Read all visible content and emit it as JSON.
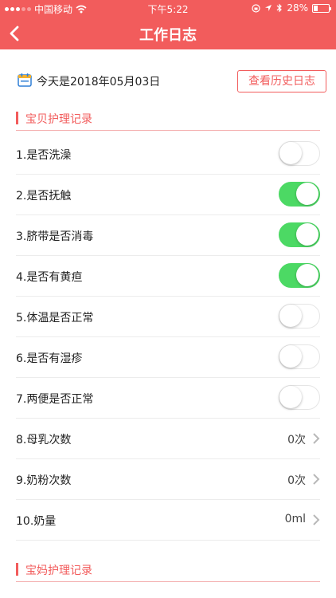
{
  "status_bar": {
    "carrier": "中国移动",
    "time": "下午5:22",
    "battery_pct": "28%",
    "battery_level": 0.28
  },
  "header": {
    "title": "工作日志"
  },
  "date": {
    "text": "今天是2018年05月03日",
    "history_btn": "查看历史日志"
  },
  "sections": {
    "baby": "宝贝护理记录",
    "mom": "宝妈护理记录"
  },
  "rows": [
    {
      "label": "1.是否洗澡",
      "type": "toggle",
      "on": false
    },
    {
      "label": "2.是否抚触",
      "type": "toggle",
      "on": true
    },
    {
      "label": "3.脐带是否消毒",
      "type": "toggle",
      "on": true
    },
    {
      "label": "4.是否有黄疸",
      "type": "toggle",
      "on": true
    },
    {
      "label": "5.体温是否正常",
      "type": "toggle",
      "on": false
    },
    {
      "label": "6.是否有湿疹",
      "type": "toggle",
      "on": false
    },
    {
      "label": "7.两便是否正常",
      "type": "toggle",
      "on": false
    },
    {
      "label": "8.母乳次数",
      "type": "value",
      "value": "0次"
    },
    {
      "label": "9.奶粉次数",
      "type": "value",
      "value": "0次"
    },
    {
      "label": "10.奶量",
      "type": "value",
      "value": "0ml"
    }
  ],
  "colors": {
    "accent": "#f25c5c",
    "toggle_on": "#4cd964"
  }
}
